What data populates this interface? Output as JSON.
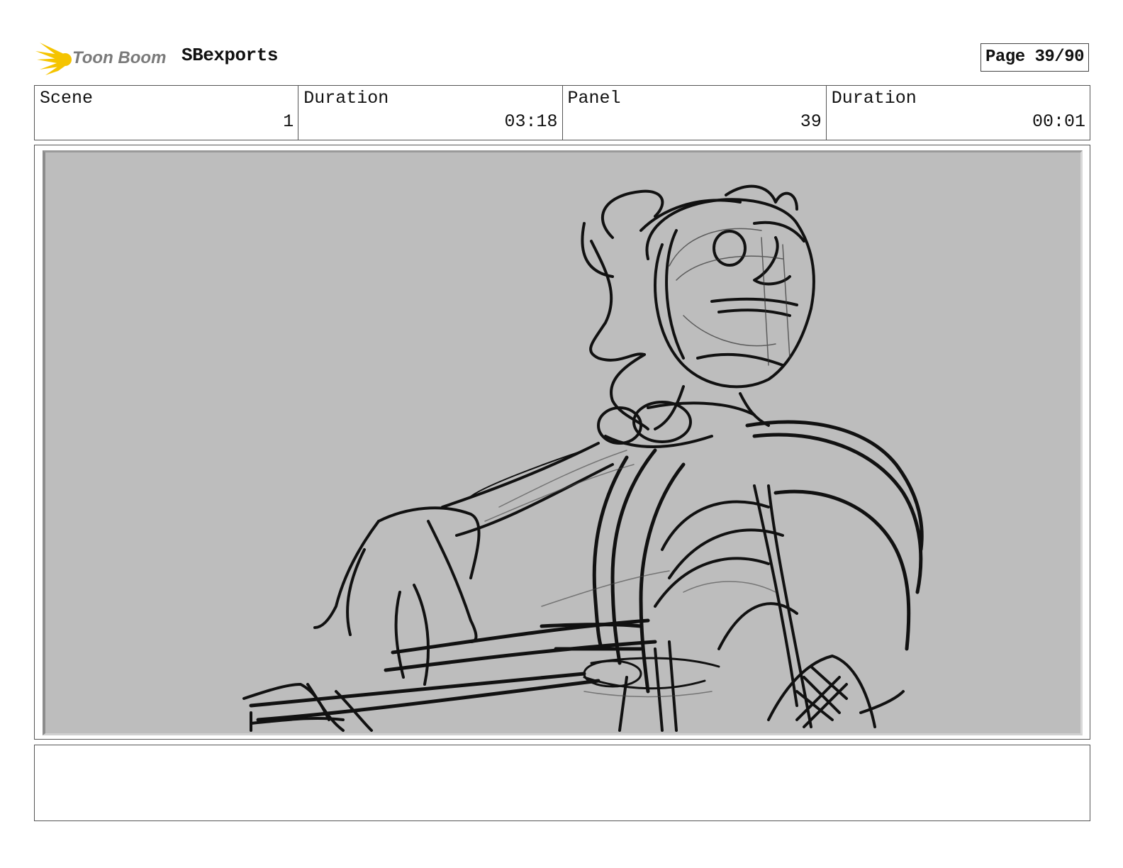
{
  "header": {
    "logo_text": "Toon Boom",
    "project_title": "SBexports",
    "page_label": "Page 39/90"
  },
  "info": [
    {
      "label": "Scene",
      "value": "1"
    },
    {
      "label": "Duration",
      "value": "03:18"
    },
    {
      "label": "Panel",
      "value": "39"
    },
    {
      "label": "Duration",
      "value": "00:01"
    }
  ],
  "panel": {
    "background_color": "#bdbdbd",
    "stroke_color": "#111111"
  },
  "notes": {
    "text": ""
  },
  "colors": {
    "logo_yellow": "#f5c400",
    "logo_text": "#7a7a7a"
  }
}
